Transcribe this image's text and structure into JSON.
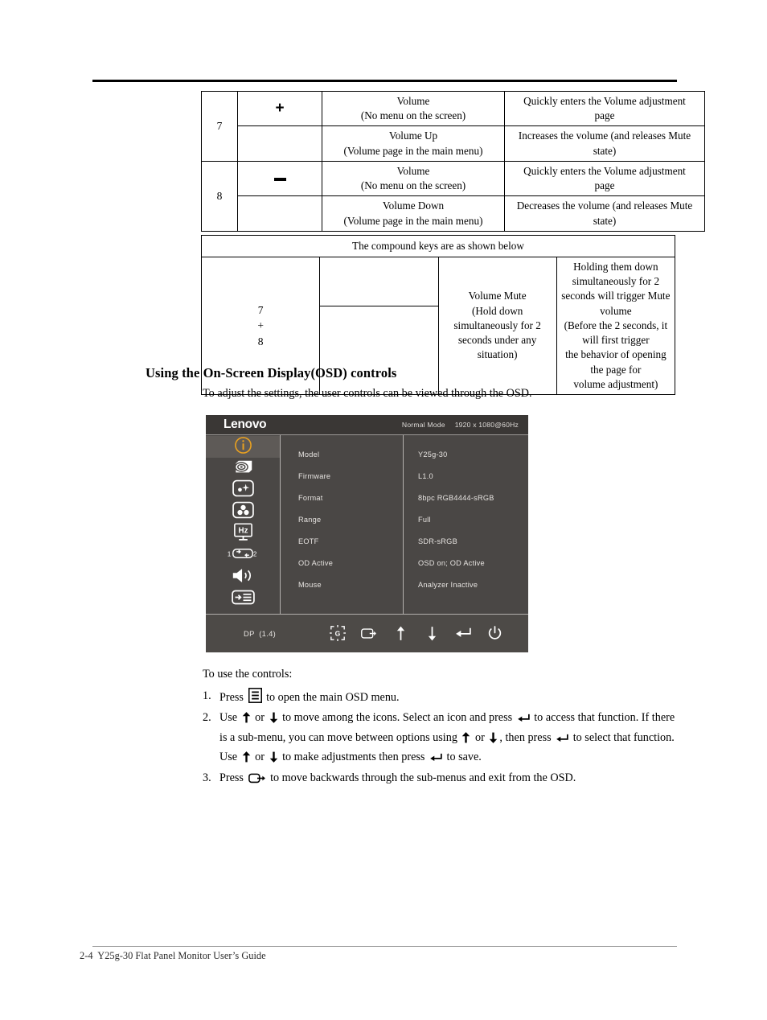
{
  "page": {
    "footer_text": "2-4  Y25g-30 Flat Panel Monitor User’s Guide"
  },
  "table_volume": {
    "rows": [
      {
        "number": "7",
        "symbol": "plus",
        "lines": [
          {
            "function": "Volume\n(No menu on the screen)",
            "function_l1": "Volume",
            "function_l2": "(No menu on the screen)",
            "description_l1": "Quickly enters the Volume adjustment",
            "description_l2": "page"
          },
          {
            "function_l1": "Volume Up",
            "function_l2": "(Volume page in the main menu)",
            "description_l1": "Increases the volume (and releases Mute",
            "description_l2": "state)"
          }
        ]
      },
      {
        "number": "8",
        "symbol": "minus",
        "lines": [
          {
            "function_l1": "Volume",
            "function_l2": "(No menu on the screen)",
            "description_l1": "Quickly enters the Volume adjustment",
            "description_l2": "page"
          },
          {
            "function_l1": "Volume Down",
            "function_l2": "(Volume page in the main menu)",
            "description_l1": "Decreases the volume (and releases Mute",
            "description_l2": "state)"
          }
        ]
      }
    ]
  },
  "table_compound": {
    "header": "The compound keys are as shown below",
    "row": {
      "number_l1": "7",
      "number_l2": "+",
      "number_l3": "8",
      "function_l1": "Volume Mute",
      "function_l2": "(Hold down simultaneously for 2",
      "function_l3": "seconds under any situation)",
      "description_l1": "Holding them down simultaneously for 2",
      "description_l2": "seconds will trigger Mute volume",
      "description_l3": "(Before the 2 seconds, it will first trigger",
      "description_l4": "the behavior of opening the page for",
      "description_l5": "volume adjustment)"
    }
  },
  "section": {
    "heading": "Using the On-Screen Display(OSD) controls",
    "subtitle": "To adjust the settings, the user controls can be viewed through the OSD."
  },
  "osd": {
    "brand": "Lenovo",
    "mode": "Normal Mode",
    "resolution": "1920 x 1080@60Hz",
    "accent_color": "#e8a020",
    "background_color": "#4a4745",
    "header_color": "#3a3735",
    "selected_color": "#5e5a57",
    "sidebar": [
      {
        "icon": "information-icon",
        "selected": true
      },
      {
        "icon": "game-setting-icon",
        "selected": false
      },
      {
        "icon": "image-brightness-icon",
        "selected": false
      },
      {
        "icon": "image-color-icon",
        "selected": false
      },
      {
        "icon": "refresh-rate-hz-icon",
        "selected": false
      },
      {
        "icon": "input-source-switch-icon",
        "selected": false
      },
      {
        "icon": "speaker-volume-icon",
        "selected": false
      },
      {
        "icon": "menu-settings-icon",
        "selected": false
      }
    ],
    "rows": [
      {
        "label": "Model",
        "value": "Y25g-30"
      },
      {
        "label": "Firmware",
        "value": "L1.0"
      },
      {
        "label": "Format",
        "value": "8bpc RGB4444-sRGB"
      },
      {
        "label": "Range",
        "value": "Full"
      },
      {
        "label": "EOTF",
        "value": "SDR-sRGB"
      },
      {
        "label": "OD Active",
        "value": "OSD on; OD Active"
      },
      {
        "label": "Mouse",
        "value": "Analyzer Inactive"
      }
    ],
    "footer": {
      "source": "DP  (1.4)",
      "keys": [
        "gamut-target-icon",
        "exit-icon",
        "arrow-up-icon",
        "arrow-down-icon",
        "enter-icon",
        "power-icon"
      ]
    }
  },
  "instructions": {
    "lead": "To use the controls:",
    "items": [
      {
        "num": "1.",
        "p1": "Press",
        "icon1": "menu-button-icon",
        "p2": "to open the main OSD menu."
      },
      {
        "num": "2.",
        "p1": "Use",
        "p2": "or",
        "p3": "to move among the icons. Select an icon and press",
        "p4": "to access that function. If there is a sub-menu, you can move between options using",
        "p5": "or",
        "p6": ",  then press",
        "p7": "to select that function. Use",
        "p8": "or",
        "p9": "to make adjustments then press",
        "p10": "to save."
      },
      {
        "num": "3.",
        "p1": "Press",
        "icon1": "exit-icon",
        "p2": "to move backwards through the sub-menus and exit from the OSD."
      }
    ]
  }
}
